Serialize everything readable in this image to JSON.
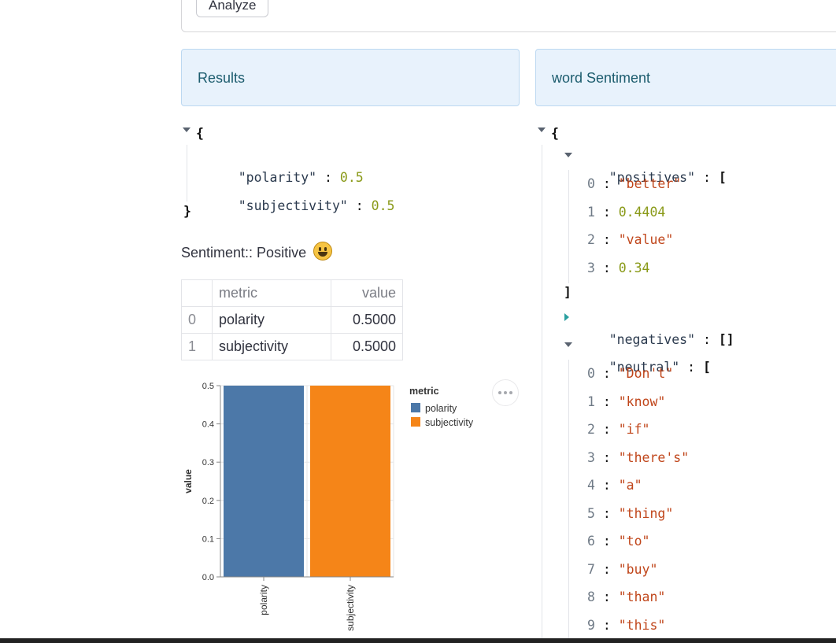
{
  "form": {
    "analyze_label": "Analyze"
  },
  "results_header": "Results",
  "word_header": "word Sentiment",
  "results_json": {
    "open": "{",
    "close": "}",
    "entries": [
      {
        "key": "\"polarity\"",
        "value": "0.5"
      },
      {
        "key": "\"subjectivity\"",
        "value": "0.5"
      }
    ]
  },
  "sentiment_text": "Sentiment:: Positive",
  "sentiment_emoji": "grinning-face-icon",
  "table": {
    "headers": [
      "",
      "metric",
      "value"
    ],
    "rows": [
      {
        "index": "0",
        "metric": "polarity",
        "value": "0.5000"
      },
      {
        "index": "1",
        "metric": "subjectivity",
        "value": "0.5000"
      }
    ]
  },
  "word_json": {
    "open": "{",
    "positives_key": "\"positives\"",
    "positives_open": "[",
    "positives": [
      {
        "i": "0",
        "v": "\"better\"",
        "t": "str"
      },
      {
        "i": "1",
        "v": "0.4404",
        "t": "num"
      },
      {
        "i": "2",
        "v": "\"value\"",
        "t": "str"
      },
      {
        "i": "3",
        "v": "0.34",
        "t": "num"
      }
    ],
    "positives_close": "]",
    "negatives_key": "\"negatives\"",
    "negatives_val": "[]",
    "neutral_key": "\"neutral\"",
    "neutral_open": "[",
    "neutral": [
      {
        "i": "0",
        "v": "\"Don't\""
      },
      {
        "i": "1",
        "v": "\"know\""
      },
      {
        "i": "2",
        "v": "\"if\""
      },
      {
        "i": "3",
        "v": "\"there's\""
      },
      {
        "i": "4",
        "v": "\"a\""
      },
      {
        "i": "5",
        "v": "\"thing\""
      },
      {
        "i": "6",
        "v": "\"to\""
      },
      {
        "i": "7",
        "v": "\"buy\""
      },
      {
        "i": "8",
        "v": "\"than\""
      },
      {
        "i": "9",
        "v": "\"this\""
      }
    ]
  },
  "colors": {
    "polarity": "#4c78a8",
    "subjectivity": "#f58518"
  },
  "chart_data": {
    "type": "bar",
    "categories": [
      "polarity",
      "subjectivity"
    ],
    "values": [
      0.5,
      0.5
    ],
    "ylabel": "value",
    "ylim": [
      0,
      0.5
    ],
    "yticks": [
      "0.0",
      "0.1",
      "0.2",
      "0.3",
      "0.4",
      "0.5"
    ],
    "legend_title": "metric",
    "legend_position": "right",
    "legend": [
      "polarity",
      "subjectivity"
    ]
  }
}
